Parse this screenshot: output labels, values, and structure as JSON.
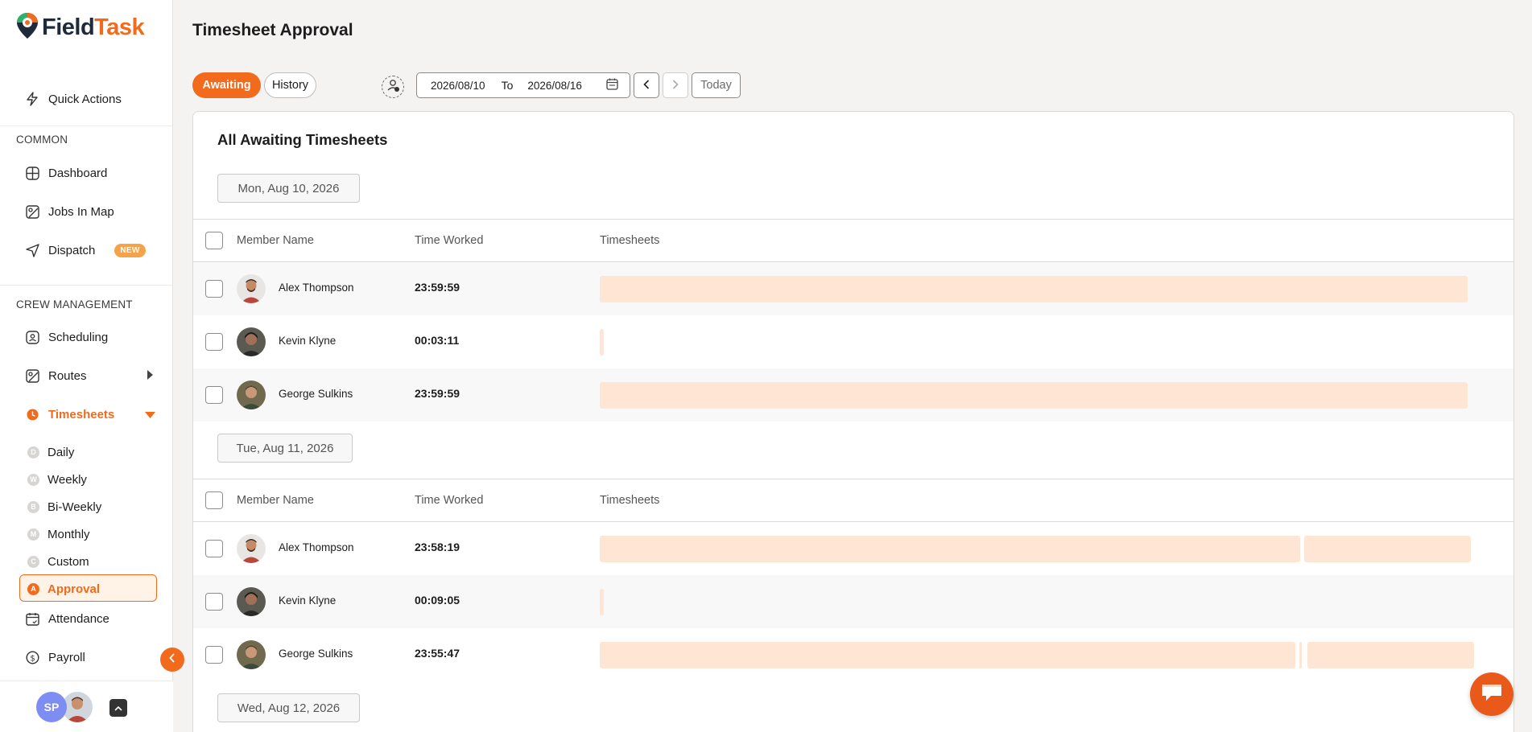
{
  "brand": {
    "name_part1": "Field",
    "name_part2": "Task"
  },
  "sidebar": {
    "quick_actions": "Quick Actions",
    "section_common": "COMMON",
    "dashboard": "Dashboard",
    "jobs_in_map": "Jobs In Map",
    "dispatch": "Dispatch",
    "dispatch_badge": "NEW",
    "section_crew": "CREW MANAGEMENT",
    "scheduling": "Scheduling",
    "routes": "Routes",
    "timesheets": "Timesheets",
    "sub": [
      {
        "letter": "D",
        "label": "Daily"
      },
      {
        "letter": "W",
        "label": "Weekly"
      },
      {
        "letter": "B",
        "label": "Bi-Weekly"
      },
      {
        "letter": "M",
        "label": "Monthly"
      },
      {
        "letter": "C",
        "label": "Custom"
      },
      {
        "letter": "A",
        "label": "Approval"
      }
    ],
    "attendance": "Attendance",
    "payroll": "Payroll",
    "user_initials": "SP"
  },
  "header": {
    "title": "Timesheet Approval"
  },
  "toolbar": {
    "tab_awaiting": "Awaiting",
    "tab_history": "History",
    "date_from": "2026/08/10",
    "to_label": "To",
    "date_to": "2026/08/16",
    "today": "Today"
  },
  "card": {
    "title": "All Awaiting Timesheets"
  },
  "columns": {
    "member": "Member Name",
    "time": "Time Worked",
    "timesheets": "Timesheets"
  },
  "days": [
    {
      "label": "Mon, Aug 10, 2026",
      "rows": [
        {
          "name": "Alex Thompson",
          "time": "23:59:59"
        },
        {
          "name": "Kevin Klyne",
          "time": "00:03:11"
        },
        {
          "name": "George Sulkins",
          "time": "23:59:59"
        }
      ]
    },
    {
      "label": "Tue, Aug 11, 2026",
      "rows": [
        {
          "name": "Alex Thompson",
          "time": "23:58:19"
        },
        {
          "name": "Kevin Klyne",
          "time": "00:09:05"
        },
        {
          "name": "George Sulkins",
          "time": "23:55:47"
        }
      ]
    },
    {
      "label": "Wed, Aug 12, 2026",
      "rows": []
    }
  ],
  "colors": {
    "accent": "#f26a1b",
    "bar": "#ffe5d3"
  }
}
